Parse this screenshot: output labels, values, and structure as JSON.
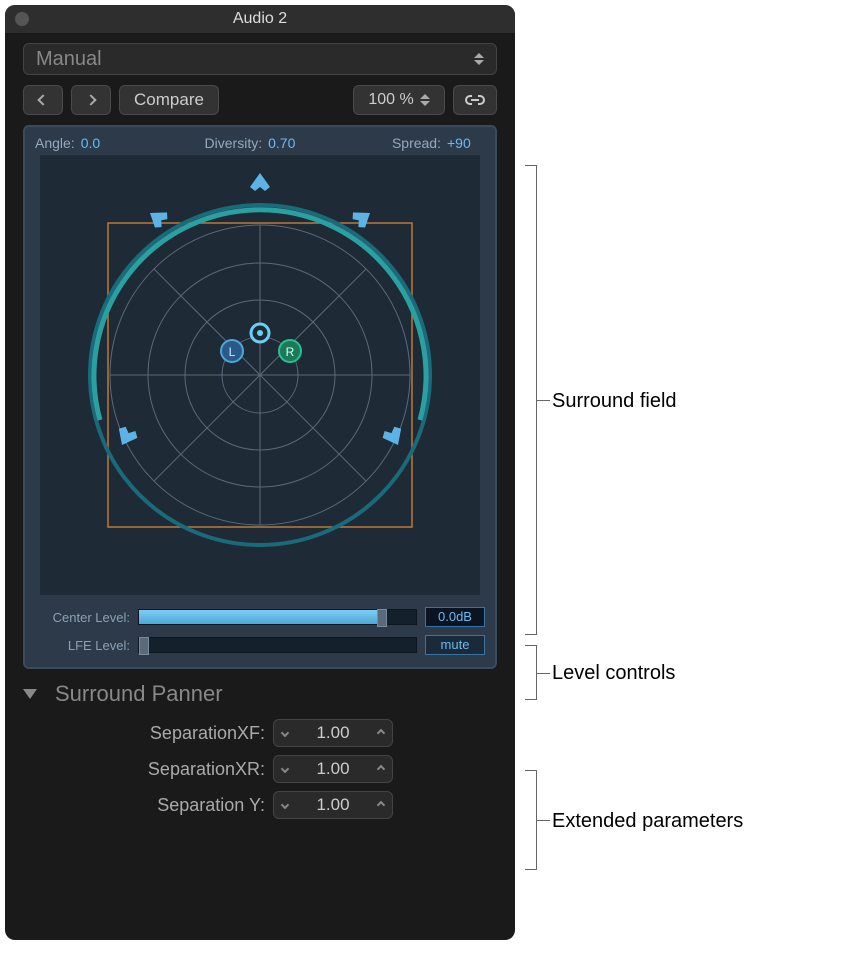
{
  "window": {
    "title": "Audio 2"
  },
  "preset": {
    "label": "Manual"
  },
  "toolbar": {
    "compare_label": "Compare",
    "zoom_value": "100 %"
  },
  "params": {
    "angle_label": "Angle:",
    "angle_value": "0.0",
    "diversity_label": "Diversity:",
    "diversity_value": "0.70",
    "spread_label": "Spread:",
    "spread_value": "+90"
  },
  "field": {
    "left_marker": "L",
    "right_marker": "R"
  },
  "levels": {
    "center_label": "Center Level:",
    "center_readout": "0.0dB",
    "lfe_label": "LFE Level:",
    "mute_label": "mute"
  },
  "extended": {
    "title": "Surround Panner",
    "rows": [
      {
        "label": "SeparationXF:",
        "value": "1.00"
      },
      {
        "label": "SeparationXR:",
        "value": "1.00"
      },
      {
        "label": "Separation Y:",
        "value": "1.00"
      }
    ]
  },
  "annotations": {
    "field": "Surround field",
    "levels": "Level controls",
    "extended": "Extended parameters"
  }
}
